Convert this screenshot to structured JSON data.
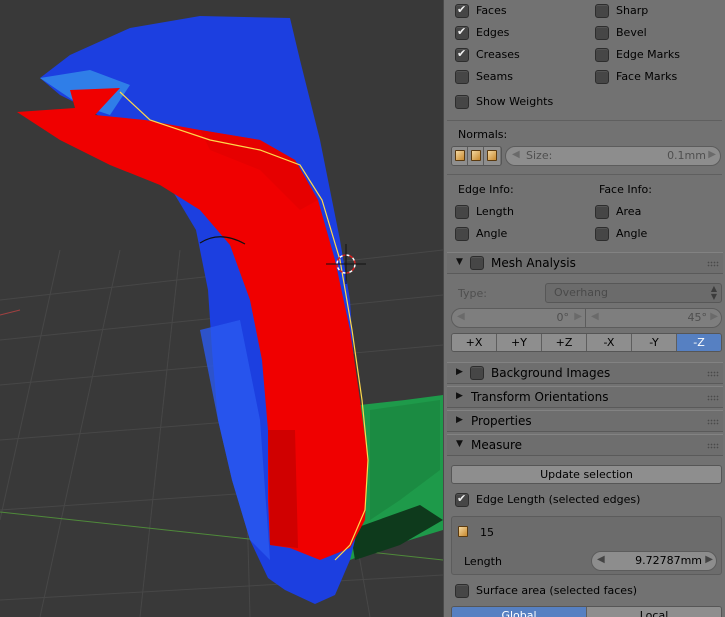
{
  "overlays": {
    "faces": {
      "label": "Faces",
      "checked": true
    },
    "sharp": {
      "label": "Sharp",
      "checked": false
    },
    "edges": {
      "label": "Edges",
      "checked": true
    },
    "bevel": {
      "label": "Bevel",
      "checked": false
    },
    "creases": {
      "label": "Creases",
      "checked": true
    },
    "edge_marks": {
      "label": "Edge Marks",
      "checked": false
    },
    "seams": {
      "label": "Seams",
      "checked": false
    },
    "face_marks": {
      "label": "Face Marks",
      "checked": false
    },
    "show_weights": {
      "label": "Show Weights",
      "checked": false
    }
  },
  "normals": {
    "label": "Normals:",
    "icons": [
      "vertex-normal-icon",
      "loop-normal-icon",
      "face-normal-icon"
    ],
    "size_label": "Size:",
    "size_value": "0.1mm"
  },
  "edge_info": {
    "label": "Edge Info:",
    "length": "Length",
    "angle": "Angle"
  },
  "face_info": {
    "label": "Face Info:",
    "area": "Area",
    "angle": "Angle"
  },
  "mesh_analysis": {
    "title": "Mesh Analysis",
    "type_label": "Type:",
    "type_value": "Overhang",
    "min_value": "0°",
    "max_value": "45°",
    "axes": [
      "+X",
      "+Y",
      "+Z",
      "-X",
      "-Y",
      "-Z"
    ],
    "active_axis": "-Z"
  },
  "collapsed_panels": [
    "Background Images",
    "Transform Orientations",
    "Properties"
  ],
  "measure": {
    "title": "Measure",
    "update_button": "Update selection",
    "edge_length_label": "Edge Length (selected edges)",
    "edge_length_checked": true,
    "count": "15",
    "length_label": "Length",
    "length_value": "9.72787mm",
    "surface_area_label": "Surface area (selected faces)",
    "surface_area_checked": false,
    "unit_tabs": [
      "Global",
      "Local"
    ],
    "active_unit_tab": "Global"
  },
  "colors": {
    "viewport_bg": "#393939",
    "panel_bg": "#727272",
    "active_blue": "#5680c2",
    "mesh_blue": "#1c3fe0",
    "mesh_red": "#f00000",
    "mesh_green": "#1e9a4a",
    "selected_edge": "#ffd84a"
  }
}
